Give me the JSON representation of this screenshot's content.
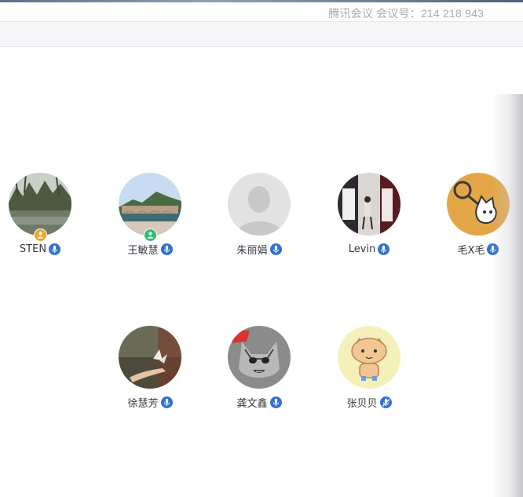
{
  "window": {
    "title": "腾讯会议 会议号：214 218 943"
  },
  "participants": [
    {
      "name": "STEN",
      "role_badge": "host",
      "badge_color": "#f0a229",
      "mic": "on",
      "avatar": "lake-photo"
    },
    {
      "name": "王敏慧",
      "role_badge": "cohost",
      "badge_color": "#2fbf71",
      "mic": "on",
      "avatar": "mountain-photo"
    },
    {
      "name": "朱丽娟",
      "mic": "on",
      "avatar": "default-person"
    },
    {
      "name": "Levin",
      "mic": "on",
      "avatar": "people-photo"
    },
    {
      "name": "毛X毛",
      "mic": "on",
      "avatar": "keychain-photo"
    },
    {
      "name": "徐慧芳",
      "mic": "on",
      "avatar": "butterfly-hand-photo"
    },
    {
      "name": "龚文鑫",
      "mic": "on",
      "avatar": "cat-photo"
    },
    {
      "name": "张贝贝",
      "mic": "off",
      "avatar": "cartoon-photo"
    }
  ],
  "colors": {
    "accent_blue": "#2f6fe0",
    "title_text": "#a7abb1",
    "name_text": "#333842"
  }
}
